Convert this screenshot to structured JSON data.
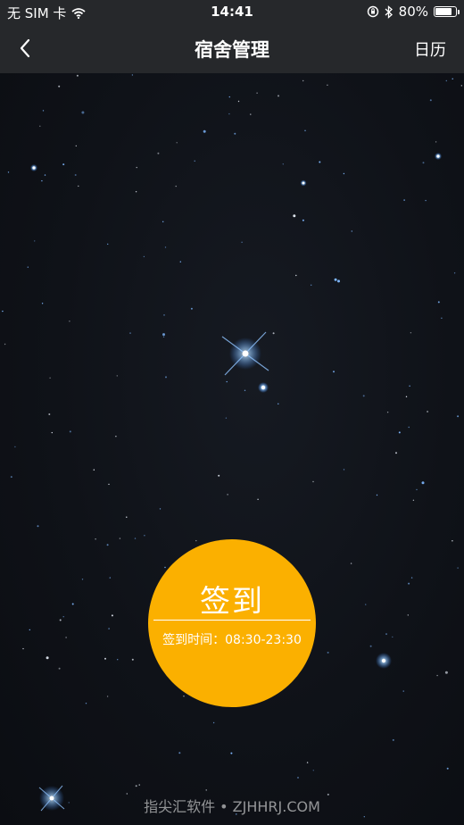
{
  "status_bar": {
    "carrier": "无 SIM 卡",
    "time": "14:41",
    "battery": "80%",
    "battery_level": 0.8,
    "wifi_icon": "wifi-icon",
    "lock_icon": "rotation-lock-icon",
    "bluetooth_icon": "bluetooth-icon"
  },
  "nav": {
    "title": "宿舍管理",
    "right_action": "日历",
    "back_icon": "chevron-left-icon"
  },
  "signin": {
    "title": "签到",
    "time_range": "签到时间：08:30-23:30",
    "color": "#fbb000"
  },
  "watermark": "指尖汇软件 • ZJHHRJ.COM"
}
